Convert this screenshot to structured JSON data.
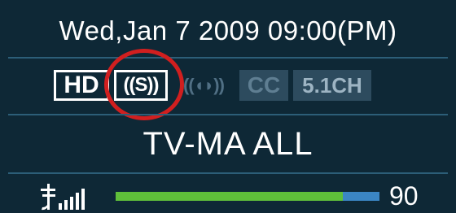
{
  "osd": {
    "datetime": "Wed,Jan 7 2009 09:00(PM)",
    "badges": {
      "hd": "HD",
      "surround": "((S))",
      "dolby": "((◖◗))",
      "cc": "CC",
      "channels": "5.1CH"
    },
    "rating": "TV-MA ALL",
    "signal": {
      "level": 0.86,
      "value": "90"
    },
    "icons": {
      "antenna": "antenna-signal-icon"
    },
    "colors": {
      "background": "#0e2836",
      "divider": "#2c5e78",
      "signal_fill": "#5fbf3a",
      "signal_track": "#3b86c4",
      "highlight": "#d11f1f"
    }
  }
}
